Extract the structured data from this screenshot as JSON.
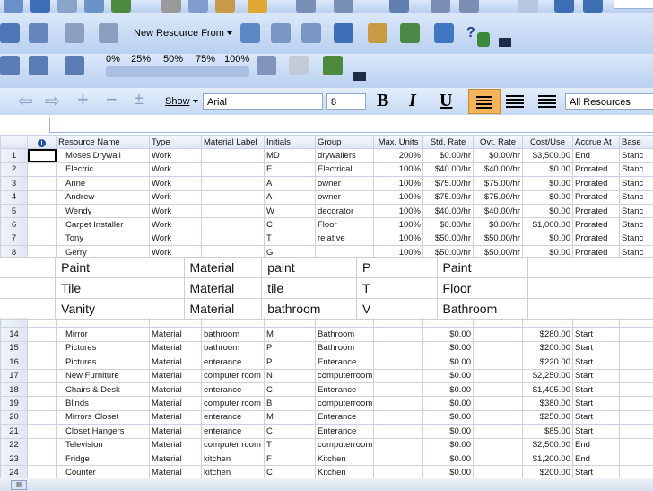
{
  "toolbar": {
    "new_resource_from": "New Resource From",
    "show_label": "Show",
    "font_name": "Arial",
    "font_size": "8",
    "bold": "B",
    "italic": "I",
    "underline": "U",
    "resource_filter": "All Resources",
    "percent_labels": [
      "0%",
      "25%",
      "50%",
      "75%",
      "100%"
    ],
    "help_text": "?"
  },
  "grid": {
    "columns": [
      "",
      "",
      "Resource Name",
      "Type",
      "Material Label",
      "Initials",
      "Group",
      "Max. Units",
      "Std. Rate",
      "Ovt. Rate",
      "Cost/Use",
      "Accrue At",
      "Base"
    ],
    "top_rows": [
      [
        "1",
        "Moses Drywall",
        "Work",
        "",
        "MD",
        "drywallers",
        "200%",
        "$0.00/hr",
        "$0.00/hr",
        "$3,500.00",
        "End",
        "Stanc"
      ],
      [
        "2",
        "Electric",
        "Work",
        "",
        "E",
        "Electrical",
        "100%",
        "$40.00/hr",
        "$40.00/hr",
        "$0.00",
        "Prorated",
        "Stanc"
      ],
      [
        "3",
        "Anne",
        "Work",
        "",
        "A",
        "owner",
        "100%",
        "$75.00/hr",
        "$75.00/hr",
        "$0.00",
        "Prorated",
        "Stanc"
      ],
      [
        "4",
        "Andrew",
        "Work",
        "",
        "A",
        "owner",
        "100%",
        "$75.00/hr",
        "$75.00/hr",
        "$0.00",
        "Prorated",
        "Stanc"
      ],
      [
        "5",
        "Wendy",
        "Work",
        "",
        "W",
        "decorator",
        "100%",
        "$40.00/hr",
        "$40.00/hr",
        "$0.00",
        "Prorated",
        "Stanc"
      ],
      [
        "6",
        "Carpet Installer",
        "Work",
        "",
        "C",
        "Floor",
        "100%",
        "$0.00/hr",
        "$0.00/hr",
        "$1,000.00",
        "Prorated",
        "Stanc"
      ],
      [
        "7",
        "Tony",
        "Work",
        "",
        "T",
        "relative",
        "100%",
        "$50.00/hr",
        "$50.00/hr",
        "$0.00",
        "Prorated",
        "Stanc"
      ],
      [
        "8",
        "Gerry",
        "Work",
        "",
        "G",
        "",
        "100%",
        "$50.00/hr",
        "$50.00/hr",
        "$0.00",
        "Prorated",
        "Stanc"
      ]
    ],
    "bottom_rows": [
      [
        "14",
        "Mirror",
        "Material",
        "bathroom",
        "M",
        "Bathroom",
        "",
        "$0.00",
        "",
        "$280.00",
        "Start",
        ""
      ],
      [
        "15",
        "Pictures",
        "Material",
        "bathroom",
        "P",
        "Bathroom",
        "",
        "$0.00",
        "",
        "$200.00",
        "Start",
        ""
      ],
      [
        "16",
        "Pictures",
        "Material",
        "enterance",
        "P",
        "Enterance",
        "",
        "$0.00",
        "",
        "$220.00",
        "Start",
        ""
      ],
      [
        "17",
        "New Furniture",
        "Material",
        "computer room",
        "N",
        "computerroom",
        "",
        "$0.00",
        "",
        "$2,250.00",
        "Start",
        ""
      ],
      [
        "18",
        "Chairs & Desk",
        "Material",
        "enterance",
        "C",
        "Enterance",
        "",
        "$0.00",
        "",
        "$1,405.00",
        "Start",
        ""
      ],
      [
        "19",
        "Blinds",
        "Material",
        "computer room",
        "B",
        "computerroom",
        "",
        "$0.00",
        "",
        "$380.00",
        "Start",
        ""
      ],
      [
        "20",
        "Mirrors Closet",
        "Material",
        "enterance",
        "M",
        "Enterance",
        "",
        "$0.00",
        "",
        "$250.00",
        "Start",
        ""
      ],
      [
        "21",
        "Closet Hangers",
        "Material",
        "enterance",
        "C",
        "Enterance",
        "",
        "$0.00",
        "",
        "$85.00",
        "Start",
        ""
      ],
      [
        "22",
        "Television",
        "Material",
        "computer room",
        "T",
        "computerroom",
        "",
        "$0.00",
        "",
        "$2,500.00",
        "End",
        ""
      ],
      [
        "23",
        "Fridge",
        "Material",
        "kitchen",
        "F",
        "Kitchen",
        "",
        "$0.00",
        "",
        "$1,200.00",
        "End",
        ""
      ],
      [
        "24",
        "Counter",
        "Material",
        "kitchen",
        "C",
        "Kitchen",
        "",
        "$0.00",
        "",
        "$200.00",
        "Start",
        ""
      ]
    ]
  },
  "overlay_rows": [
    [
      "Paint",
      "Material",
      "paint",
      "P",
      "Paint"
    ],
    [
      "Tile",
      "Material",
      "tile",
      "T",
      "Floor"
    ],
    [
      "Vanity",
      "Material",
      "bathroom",
      "V",
      "Bathroom"
    ]
  ],
  "colors": {
    "toolbar_bg": "#c9dcf5",
    "active_button": "#f5b35b",
    "grid_border": "#c9d3e3",
    "header_bg": "#e6ecf5"
  },
  "scroll_thumb_label": "III"
}
